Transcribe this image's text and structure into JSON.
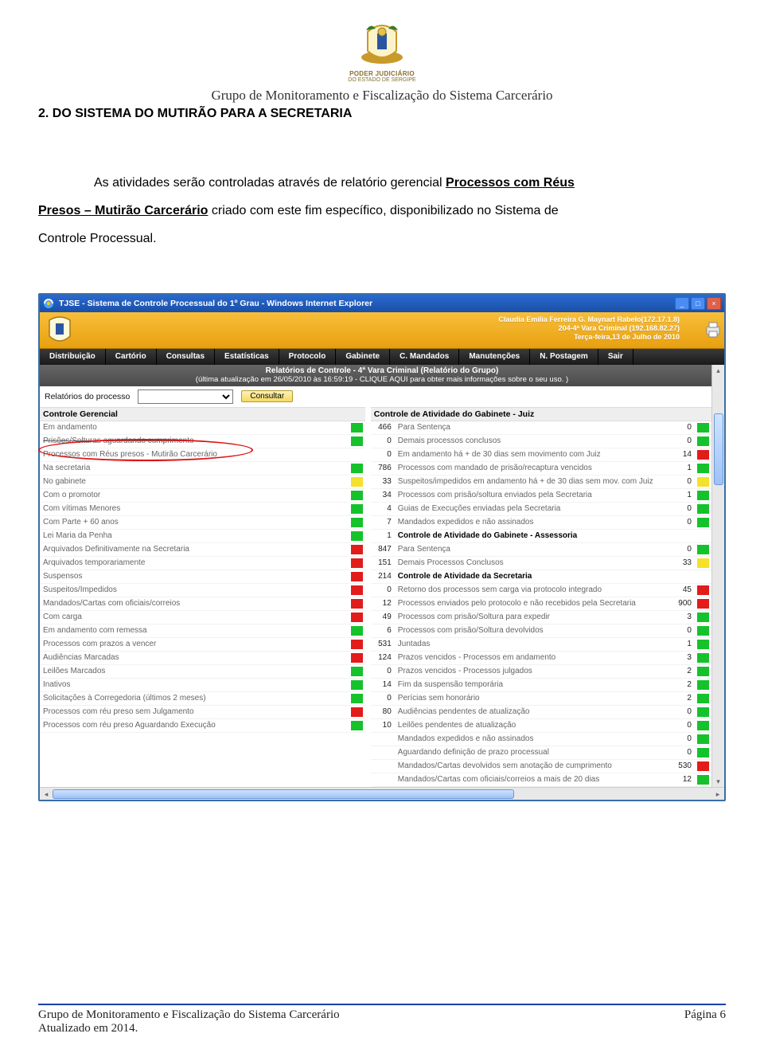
{
  "header": {
    "crest_top": "PODER JUDICIÁRIO",
    "crest_sub": "DO ESTADO DE SERGIPE",
    "org_line": "Grupo de Monitoramento e Fiscalização do Sistema Carcerário",
    "section_title": "2. DO SISTEMA DO MUTIRÃO PARA A SECRETARIA"
  },
  "body": {
    "para_pre": "As atividades serão controladas através de relatório gerencial ",
    "para_link1": "Processos com Réus",
    "para_link2": "Presos – Mutirão Carcerário",
    "para_post1": " criado com este fim específico, disponibilizado no Sistema de",
    "para_line2": "Controle Processual."
  },
  "browser": {
    "title": "TJSE - Sistema de Controle Processual do 1º Grau - Windows Internet Explorer",
    "win_min": "_",
    "win_max": "□",
    "win_close": "×"
  },
  "app_header": {
    "user_line1": "Claudia Emilia Ferreira G. Maynart Rabelo(172.17.1.8)",
    "user_line2": "204-4ª Vara Criminal    (192.168.82.27)",
    "user_line3": "Terça-feira,13 de Julho de 2010"
  },
  "menu": [
    "Distribuição",
    "Cartório",
    "Consultas",
    "Estatísticas",
    "Protocolo",
    "Gabinete",
    "C. Mandados",
    "Manutenções",
    "N. Postagem",
    "Sair"
  ],
  "subhdr": {
    "title": "Relatórios de Controle - 4ª Vara Criminal (Relatório do Grupo)",
    "info": "(última atualização em 26/05/2010 às 16:59:19 - CLIQUE AQUI para obter mais informações sobre o seu uso. )"
  },
  "controls": {
    "label": "Relatórios do processo",
    "button": "Consultar"
  },
  "left": {
    "group_title": "Controle Gerencial",
    "rows": [
      {
        "name": "Em andamento",
        "color": "g"
      },
      {
        "name": "Prisões/Solturas aguardando cumprimento",
        "color": "g",
        "strike": true
      },
      {
        "name": "Processos com Réus presos - Mutirão Carcerário",
        "color": ""
      },
      {
        "name": "Na secretaria",
        "color": "g"
      },
      {
        "name": "No gabinete",
        "color": "y"
      },
      {
        "name": "Com o promotor",
        "color": "g"
      },
      {
        "name": "Com vítimas Menores",
        "color": "g"
      },
      {
        "name": "Com Parte + 60 anos",
        "color": "g"
      },
      {
        "name": "Lei Maria da Penha",
        "color": "g"
      },
      {
        "name": "Arquivados Definitivamente na Secretaria",
        "color": "r"
      },
      {
        "name": "Arquivados temporariamente",
        "color": "r"
      },
      {
        "name": "Suspensos",
        "color": "r"
      },
      {
        "name": "Suspeitos/Impedidos",
        "color": "r"
      },
      {
        "name": "Mandados/Cartas com oficiais/correios",
        "color": "r"
      },
      {
        "name": "Com carga",
        "color": "r"
      },
      {
        "name": "Em andamento com remessa",
        "color": "g"
      },
      {
        "name": "Processos com prazos a vencer",
        "color": "r"
      },
      {
        "name": "Audiências Marcadas",
        "color": "r"
      },
      {
        "name": "Leilões Marcados",
        "color": "g"
      },
      {
        "name": "Inativos",
        "color": "g"
      },
      {
        "name": "Solicitações à Corregedoria (últimos 2 meses)",
        "color": "g"
      },
      {
        "name": "Processos com réu preso sem Julgamento",
        "color": "r"
      },
      {
        "name": "Processos com réu preso Aguardando Execução",
        "color": "g"
      }
    ]
  },
  "right": {
    "group1_title": "Controle de Atividade do Gabinete - Juiz",
    "group1": [
      {
        "num": "466",
        "name": "Para Sentença",
        "val": "0",
        "color": "g"
      },
      {
        "num": "0",
        "name": "Demais processos conclusos",
        "val": "0",
        "color": "g"
      },
      {
        "num": "0",
        "name": "Em andamento há + de 30 dias sem movimento com Juiz",
        "val": "14",
        "color": "r"
      },
      {
        "num": "786",
        "name": "Processos com mandado de prisão/recaptura vencidos",
        "val": "1",
        "color": "g"
      },
      {
        "num": "33",
        "name": "Suspeitos/impedidos em andamento há + de 30 dias sem mov. com Juiz",
        "val": "0",
        "color": "y"
      },
      {
        "num": "34",
        "name": "Processos com prisão/soltura enviados pela Secretaria",
        "val": "1",
        "color": "g"
      },
      {
        "num": "4",
        "name": "Guias de Execuções enviadas pela Secretaria",
        "val": "0",
        "color": "g"
      },
      {
        "num": "7",
        "name": "Mandados expedidos e não assinados",
        "val": "0",
        "color": "g"
      }
    ],
    "group2_title": "Controle de Atividade do Gabinete - Assessoria",
    "group2": [
      {
        "num": "847",
        "name": "Para Sentença",
        "val": "0",
        "color": "g"
      },
      {
        "num": "151",
        "name": "Demais Processos Conclusos",
        "val": "33",
        "color": "y"
      }
    ],
    "group3_title": "Controle de Atividade da Secretaria",
    "group3": [
      {
        "num": "0",
        "name": "Retorno dos processos sem carga via  protocolo integrado",
        "val": "45",
        "color": "r"
      },
      {
        "num": "12",
        "name": "Processos enviados pelo protocolo e não recebidos pela Secretaria",
        "val": "900",
        "color": "r"
      },
      {
        "num": "49",
        "name": "Processos com prisão/Soltura para expedir",
        "val": "3",
        "color": "g"
      },
      {
        "num": "6",
        "name": "Processos com prisão/Soltura devolvidos",
        "val": "0",
        "color": "g"
      },
      {
        "num": "531",
        "name": "Juntadas",
        "val": "1",
        "color": "g"
      },
      {
        "num": "124",
        "name": "Prazos vencidos - Processos em andamento",
        "val": "3",
        "color": "g"
      },
      {
        "num": "0",
        "name": "Prazos vencidos - Processos julgados",
        "val": "2",
        "color": "g"
      },
      {
        "num": "14",
        "name": "Fim da suspensão temporária",
        "val": "2",
        "color": "g"
      },
      {
        "num": "0",
        "name": "Perícias sem honorário",
        "val": "2",
        "color": "g"
      },
      {
        "num": "80",
        "name": "Audiências pendentes de atualização",
        "val": "0",
        "color": "g"
      },
      {
        "num": "10",
        "name": "Leilões pendentes de atualização",
        "val": "0",
        "color": "g"
      },
      {
        "num": "",
        "name": "Mandados expedidos e não assinados",
        "val": "0",
        "color": "g"
      },
      {
        "num": "",
        "name": "Aguardando definição de prazo processual",
        "val": "0",
        "color": "g"
      },
      {
        "num": "",
        "name": "Mandados/Cartas devolvidos sem anotação de cumprimento",
        "val": "530",
        "color": "r"
      },
      {
        "num": "",
        "name": "Mandados/Cartas com oficiais/correios a mais de 20 dias",
        "val": "12",
        "color": "g"
      }
    ],
    "group2_numprefix": "1",
    "group3_numprefix": "214"
  },
  "footer": {
    "line1": "Grupo de Monitoramento e Fiscalização do Sistema Carcerário",
    "line2": "Atualizado em 2014.",
    "page": "Página 6"
  }
}
